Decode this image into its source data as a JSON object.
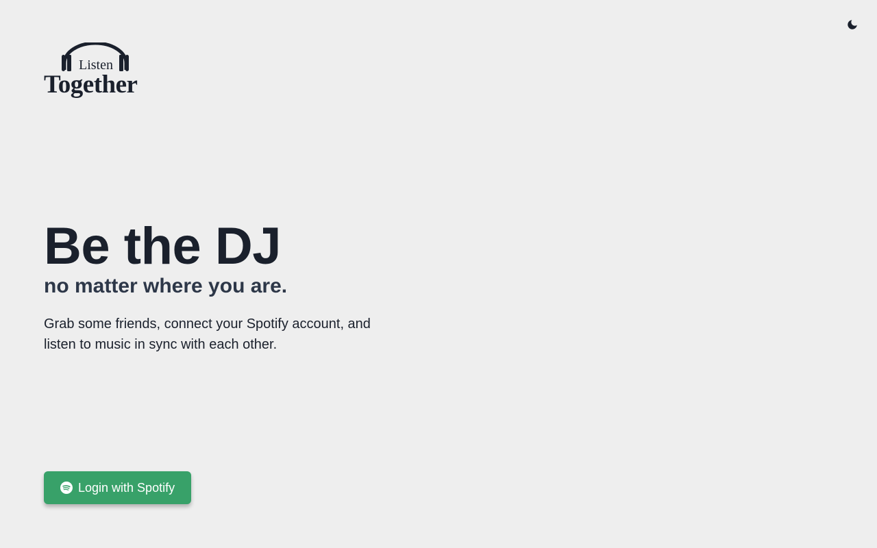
{
  "brand": {
    "logo_top_word": "Listen",
    "logo_bottom_word": "Together"
  },
  "theme_toggle": {
    "icon": "moon-icon"
  },
  "hero": {
    "title": "Be the DJ",
    "subtitle": "no matter where you are.",
    "description": "Grab some friends, connect your Spotify account, and listen to music in sync with each other."
  },
  "login": {
    "label": "Login with Spotify",
    "icon": "spotify-icon"
  },
  "colors": {
    "background": "#eeeeee",
    "text": "#1a202c",
    "subtitle": "#2d3748",
    "button": "#38a169"
  }
}
